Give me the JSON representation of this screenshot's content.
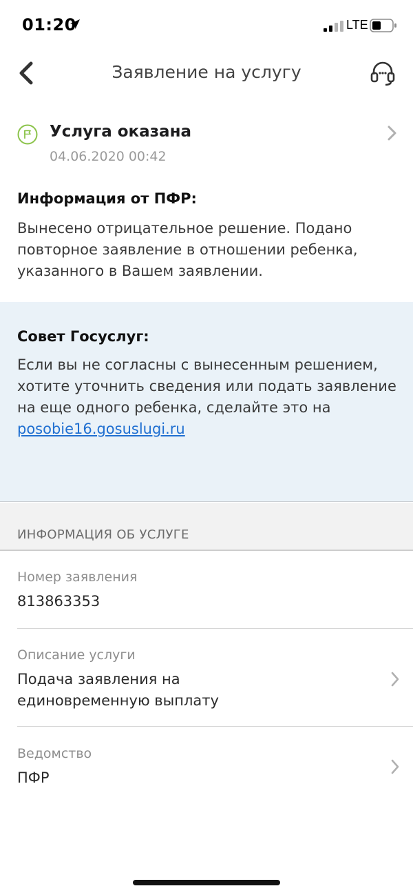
{
  "status_bar": {
    "time": "01:20",
    "network": "LTE"
  },
  "nav": {
    "title": "Заявление на услугу"
  },
  "status": {
    "title": "Услуга оказана",
    "date": "04.06.2020 00:42",
    "icon_color": "#8bc34a"
  },
  "pfr_info": {
    "heading": "Информация от ПФР:",
    "text": "Вынесено отрицательное решение. Подано повторное заявление в отношении ребенка, указанного в Вашем заявлении."
  },
  "advice": {
    "heading": "Совет Госуслуг:",
    "text": "Если вы не согласны с вынесенным решением, хотите уточнить сведения или подать заявление на еще одного ребенка, сделайте это на ",
    "link": "posobie16.gosuslugi.ru",
    "background": "#eaf2f8",
    "link_color": "#1f6fd1"
  },
  "service_info": {
    "section_title": "ИНФОРМАЦИЯ ОБ УСЛУГЕ",
    "rows": [
      {
        "label": "Номер заявления",
        "value": "813863353"
      },
      {
        "label": "Описание услуги",
        "value": "Подача заявления на единовременную выплату"
      },
      {
        "label": "Ведомство",
        "value": "ПФР"
      }
    ]
  }
}
